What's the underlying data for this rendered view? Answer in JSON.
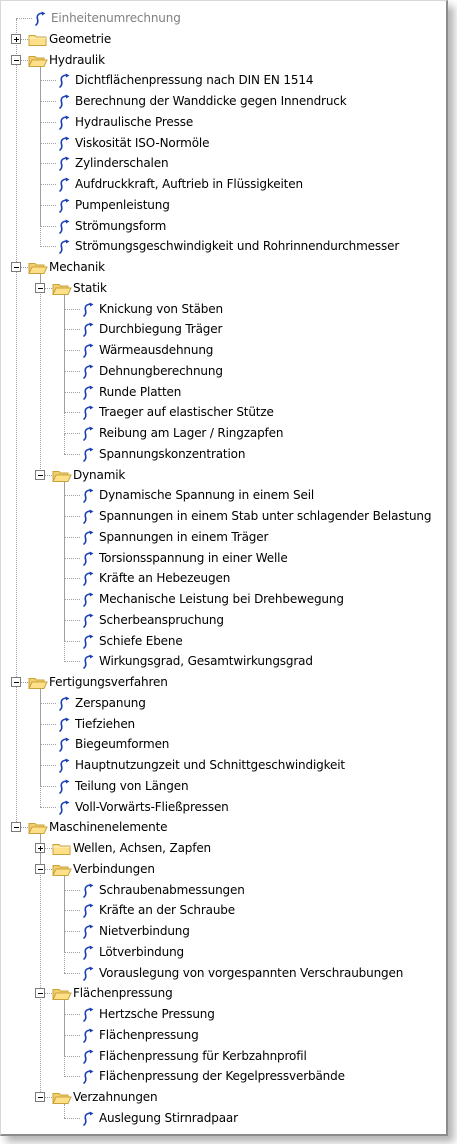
{
  "tree": {
    "items": [
      {
        "label": "Einheitenumrechnung",
        "level": 0,
        "type": "leaf",
        "disabled": true
      },
      {
        "label": "Geometrie",
        "level": 0,
        "type": "folder",
        "expanded": false
      },
      {
        "label": "Hydraulik",
        "level": 0,
        "type": "folder",
        "expanded": true
      },
      {
        "label": "Dichtflächenpressung nach DIN EN 1514",
        "level": 1,
        "type": "leaf"
      },
      {
        "label": "Berechnung der Wanddicke gegen Innendruck",
        "level": 1,
        "type": "leaf"
      },
      {
        "label": "Hydraulische Presse",
        "level": 1,
        "type": "leaf"
      },
      {
        "label": "Viskosität ISO-Normöle",
        "level": 1,
        "type": "leaf"
      },
      {
        "label": "Zylinderschalen",
        "level": 1,
        "type": "leaf"
      },
      {
        "label": "Aufdruckkraft, Auftrieb in Flüssigkeiten",
        "level": 1,
        "type": "leaf"
      },
      {
        "label": "Pumpenleistung",
        "level": 1,
        "type": "leaf"
      },
      {
        "label": "Strömungsform",
        "level": 1,
        "type": "leaf"
      },
      {
        "label": "Strömungsgeschwindigkeit und Rohrinnendurchmesser",
        "level": 1,
        "type": "leaf"
      },
      {
        "label": "Mechanik",
        "level": 0,
        "type": "folder",
        "expanded": true
      },
      {
        "label": "Statik",
        "level": 1,
        "type": "folder",
        "expanded": true
      },
      {
        "label": "Knickung von Stäben",
        "level": 2,
        "type": "leaf"
      },
      {
        "label": "Durchbiegung Träger",
        "level": 2,
        "type": "leaf"
      },
      {
        "label": "Wärmeausdehnung",
        "level": 2,
        "type": "leaf"
      },
      {
        "label": "Dehnungberechnung",
        "level": 2,
        "type": "leaf"
      },
      {
        "label": "Runde Platten",
        "level": 2,
        "type": "leaf"
      },
      {
        "label": "Traeger auf elastischer Stütze",
        "level": 2,
        "type": "leaf"
      },
      {
        "label": "Reibung am Lager / Ringzapfen",
        "level": 2,
        "type": "leaf"
      },
      {
        "label": "Spannungskonzentration",
        "level": 2,
        "type": "leaf"
      },
      {
        "label": "Dynamik",
        "level": 1,
        "type": "folder",
        "expanded": true
      },
      {
        "label": "Dynamische Spannung in einem Seil",
        "level": 2,
        "type": "leaf"
      },
      {
        "label": "Spannungen in einem Stab unter schlagender Belastung",
        "level": 2,
        "type": "leaf"
      },
      {
        "label": "Spannungen in einem Träger",
        "level": 2,
        "type": "leaf"
      },
      {
        "label": "Torsionsspannung in einer Welle",
        "level": 2,
        "type": "leaf"
      },
      {
        "label": "Kräfte an Hebezeugen",
        "level": 2,
        "type": "leaf"
      },
      {
        "label": "Mechanische Leistung bei Drehbewegung",
        "level": 2,
        "type": "leaf"
      },
      {
        "label": "Scherbeanspruchung",
        "level": 2,
        "type": "leaf"
      },
      {
        "label": "Schiefe Ebene",
        "level": 2,
        "type": "leaf"
      },
      {
        "label": "Wirkungsgrad, Gesamtwirkungsgrad",
        "level": 2,
        "type": "leaf"
      },
      {
        "label": "Fertigungsverfahren",
        "level": 0,
        "type": "folder",
        "expanded": true
      },
      {
        "label": "Zerspanung",
        "level": 1,
        "type": "leaf"
      },
      {
        "label": "Tiefziehen",
        "level": 1,
        "type": "leaf"
      },
      {
        "label": "Biegeumformen",
        "level": 1,
        "type": "leaf"
      },
      {
        "label": "Hauptnutzungzeit und Schnittgeschwindigkeit",
        "level": 1,
        "type": "leaf"
      },
      {
        "label": "Teilung von Längen",
        "level": 1,
        "type": "leaf"
      },
      {
        "label": "Voll-Vorwärts-Fließpressen",
        "level": 1,
        "type": "leaf"
      },
      {
        "label": "Maschinenelemente",
        "level": 0,
        "type": "folder",
        "expanded": true
      },
      {
        "label": "Wellen, Achsen, Zapfen",
        "level": 1,
        "type": "folder",
        "expanded": false
      },
      {
        "label": "Verbindungen",
        "level": 1,
        "type": "folder",
        "expanded": true
      },
      {
        "label": "Schraubenabmessungen",
        "level": 2,
        "type": "leaf"
      },
      {
        "label": "Kräfte an der Schraube",
        "level": 2,
        "type": "leaf"
      },
      {
        "label": "Nietverbindung",
        "level": 2,
        "type": "leaf"
      },
      {
        "label": "Lötverbindung",
        "level": 2,
        "type": "leaf"
      },
      {
        "label": "Vorauslegung von vorgespannten Verschraubungen",
        "level": 2,
        "type": "leaf"
      },
      {
        "label": "Flächenpressung",
        "level": 1,
        "type": "folder",
        "expanded": true
      },
      {
        "label": "Hertzsche Pressung",
        "level": 2,
        "type": "leaf"
      },
      {
        "label": "Flächenpressung",
        "level": 2,
        "type": "leaf"
      },
      {
        "label": "Flächenpressung für Kerbzahnprofil",
        "level": 2,
        "type": "leaf"
      },
      {
        "label": "Flächenpressung der Kegelpressverbände",
        "level": 2,
        "type": "leaf"
      },
      {
        "label": "Verzahnungen",
        "level": 1,
        "type": "folder",
        "expanded": true
      },
      {
        "label": "Auslegung Stirnradpaar",
        "level": 2,
        "type": "leaf"
      }
    ]
  },
  "colors": {
    "folder_fill": "#ffe08a",
    "folder_border": "#c9a23a",
    "leaf_icon": "#1a3fb5",
    "tree_lines": "#a0a0a0",
    "disabled_text": "#808080"
  }
}
